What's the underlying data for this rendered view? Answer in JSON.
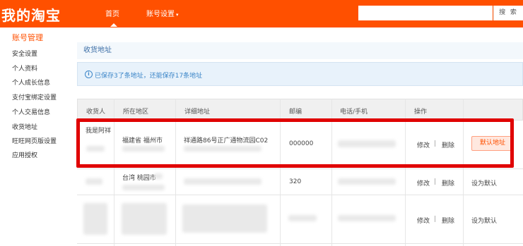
{
  "header": {
    "brand": "我的淘宝",
    "nav_home": "首页",
    "nav_account": "账号设置",
    "nav_account_caret": "▾",
    "search_placeholder": "",
    "search_button": "搜 索",
    "accent_color": "#ff5000"
  },
  "sidebar": {
    "title": "账号管理",
    "items": [
      {
        "label": "安全设置"
      },
      {
        "label": "个人资料"
      },
      {
        "label": "个人成长信息"
      },
      {
        "label": "支付宝绑定设置"
      },
      {
        "label": "个人交易信息"
      },
      {
        "label": "收货地址"
      },
      {
        "label": "旺旺网页版设置"
      },
      {
        "label": "应用授权"
      }
    ]
  },
  "main": {
    "section_title": "收货地址",
    "info_icon": "i",
    "info_text": "已保存3了条地址，还能保存17条地址",
    "table": {
      "headers": [
        "收货人",
        "所在地区",
        "详细地址",
        "邮编",
        "电话/手机",
        "操作"
      ],
      "rows": [
        {
          "recipient": "我是阿祥",
          "region": "福建省 福州市",
          "detail": "祥通路86号正广通物流园C02",
          "zipcode": "000000",
          "edit": "修改",
          "sep": "|",
          "delete": "删除",
          "default_label": "默认地址"
        },
        {
          "recipient": "",
          "region": "台湾 桃园市",
          "detail": "",
          "zipcode": "320",
          "edit": "修改",
          "sep": "|",
          "delete": "删除",
          "default_label": "设为默认"
        },
        {
          "recipient": "",
          "region": "",
          "detail": "",
          "zipcode": "",
          "edit": "修改",
          "sep": "|",
          "delete": "删除",
          "default_label": "设为默认"
        }
      ]
    }
  }
}
